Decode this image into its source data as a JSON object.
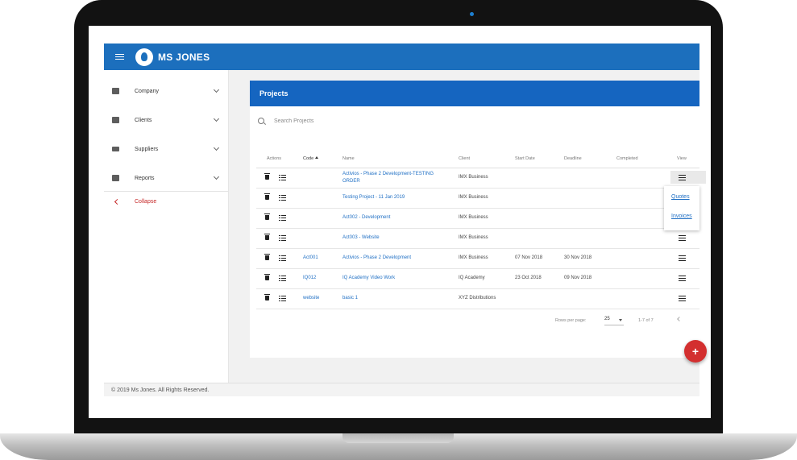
{
  "app": {
    "title": "MS JONES"
  },
  "sidebar": {
    "items": [
      {
        "label": "Company",
        "icon": "building-icon"
      },
      {
        "label": "Clients",
        "icon": "contact-card-icon"
      },
      {
        "label": "Suppliers",
        "icon": "truck-icon"
      },
      {
        "label": "Reports",
        "icon": "chart-icon"
      }
    ],
    "collapse_label": "Collapse"
  },
  "projects": {
    "title": "Projects",
    "search_placeholder": "Search Projects",
    "columns": {
      "actions": "Actions",
      "code": "Code",
      "name": "Name",
      "client": "Client",
      "start_date": "Start Date",
      "deadline": "Deadline",
      "completed": "Completed",
      "view": "View"
    },
    "sort_column": "Code",
    "rows": [
      {
        "code": "",
        "name": "Activios - Phase 2 Development-TESTING ORDER",
        "client": "IMX Business",
        "start": "",
        "deadline": "",
        "completed": ""
      },
      {
        "code": "",
        "name": "Testing Project - 11 Jan 2019",
        "client": "IMX Business",
        "start": "",
        "deadline": "",
        "completed": ""
      },
      {
        "code": "",
        "name": "Act002 - Development",
        "client": "IMX Business",
        "start": "",
        "deadline": "",
        "completed": ""
      },
      {
        "code": "",
        "name": "Act003 - Website",
        "client": "IMX Business",
        "start": "",
        "deadline": "",
        "completed": ""
      },
      {
        "code": "Act001",
        "name": "Activios - Phase 2 Development",
        "client": "IMX Business",
        "start": "07 Nov 2018",
        "deadline": "30 Nov 2018",
        "completed": ""
      },
      {
        "code": "IQ012",
        "name": "IQ Academy Video Work",
        "client": "IQ Academy",
        "start": "23 Oct 2018",
        "deadline": "09 Nov 2018",
        "completed": ""
      },
      {
        "code": "website",
        "name": "basic 1",
        "client": "XYZ Distributions",
        "start": "",
        "deadline": "",
        "completed": ""
      }
    ],
    "view_menu": {
      "items": [
        "Quotes",
        "Invoices"
      ]
    },
    "pagination": {
      "rows_per_page_label": "Rows per page:",
      "rows_per_page": "25",
      "range": "1-7 of 7"
    },
    "fab_label": "+"
  },
  "footer": {
    "text": "© 2019 Ms Jones. All Rights Reserved."
  },
  "colors": {
    "primary": "#1c6fbd",
    "header": "#1565c0",
    "accent": "#d32f2f",
    "link": "#1f6fc4"
  }
}
